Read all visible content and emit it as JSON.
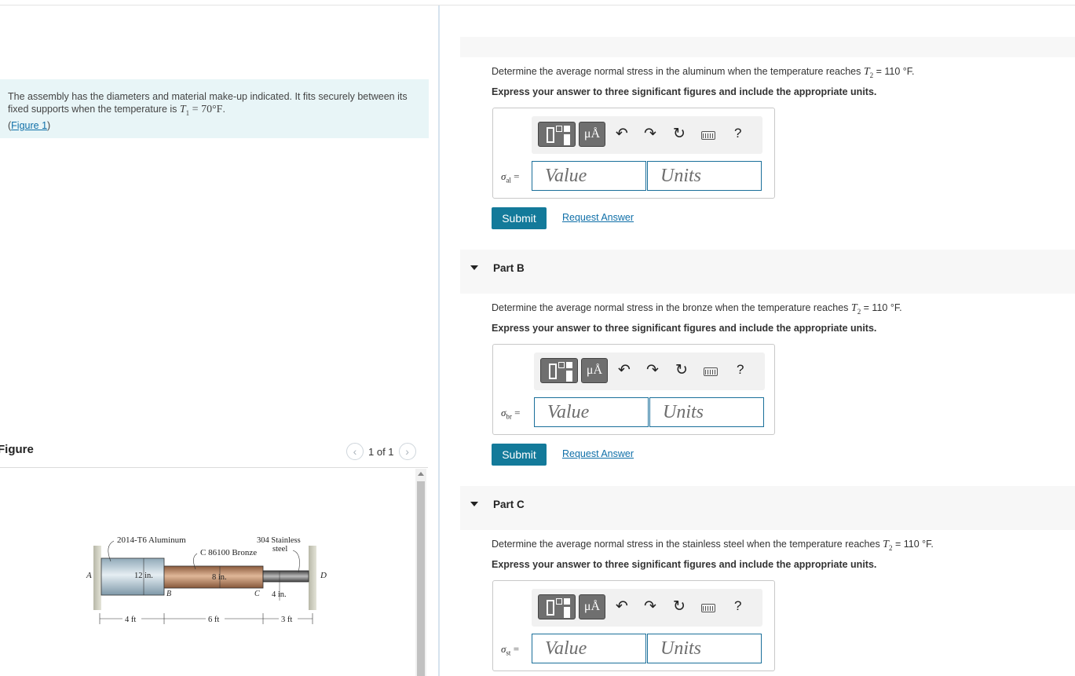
{
  "intro": {
    "text_a": "The assembly has the diameters and material make-up indicated. It fits securely between its fixed supports when the temperature is ",
    "t1_symbol": "T",
    "t1_sub": "1",
    "t1_value": " = 70°F",
    "text_b": ".",
    "figure_link": "Figure 1"
  },
  "figure_panel": {
    "title": "Figure",
    "pager": "1 of 1",
    "labels": {
      "aluminum": "2014-T6 Aluminum",
      "bronze": "C 86100 Bronze",
      "steel_line1": "304 Stainless",
      "steel_line2": "steel",
      "point_a": "A",
      "point_b": "B",
      "point_c": "C",
      "point_d": "D",
      "dia_al": "12 in.",
      "dia_br": "8 in.",
      "dia_st": "4 in.",
      "len_al": "4 ft",
      "len_br": "6 ft",
      "len_st": "3 ft"
    }
  },
  "parts": [
    {
      "label": "",
      "question_a": "Determine the average normal stress in the aluminum when the temperature reaches ",
      "t2": "T",
      "t2_sub": "2",
      "question_b": " = 110 °F.",
      "instruction": "Express your answer to three significant figures and include the appropriate units.",
      "symbol": "σ",
      "symbol_sub": "al",
      "value_placeholder": "Value",
      "units_placeholder": "Units",
      "submit": "Submit",
      "request": "Request Answer"
    },
    {
      "label": "Part B",
      "question_a": "Determine the average normal stress in the bronze when the temperature reaches ",
      "t2": "T",
      "t2_sub": "2",
      "question_b": " = 110 °F.",
      "instruction": "Express your answer to three significant figures and include the appropriate units.",
      "symbol": "σ",
      "symbol_sub": "br",
      "value_placeholder": "Value",
      "units_placeholder": "Units",
      "submit": "Submit",
      "request": "Request Answer"
    },
    {
      "label": "Part C",
      "question_a": "Determine the average normal stress in the stainless steel when the temperature reaches ",
      "t2": "T",
      "t2_sub": "2",
      "question_b": " = 110 °F.",
      "instruction": "Express your answer to three significant figures and include the appropriate units.",
      "symbol": "σ",
      "symbol_sub": "st",
      "value_placeholder": "Value",
      "units_placeholder": "Units"
    }
  ],
  "toolbar": {
    "units_button": "μÅ",
    "undo_icon": "undo-icon",
    "redo_icon": "redo-icon",
    "reset_icon": "reset-icon",
    "keyboard_icon": "keyboard-icon",
    "help": "?"
  },
  "colors": {
    "submit_bg": "#137a9a",
    "link": "#0f6fa8",
    "intro_bg": "#e8f5f7",
    "field_border": "#1a6f9a"
  }
}
